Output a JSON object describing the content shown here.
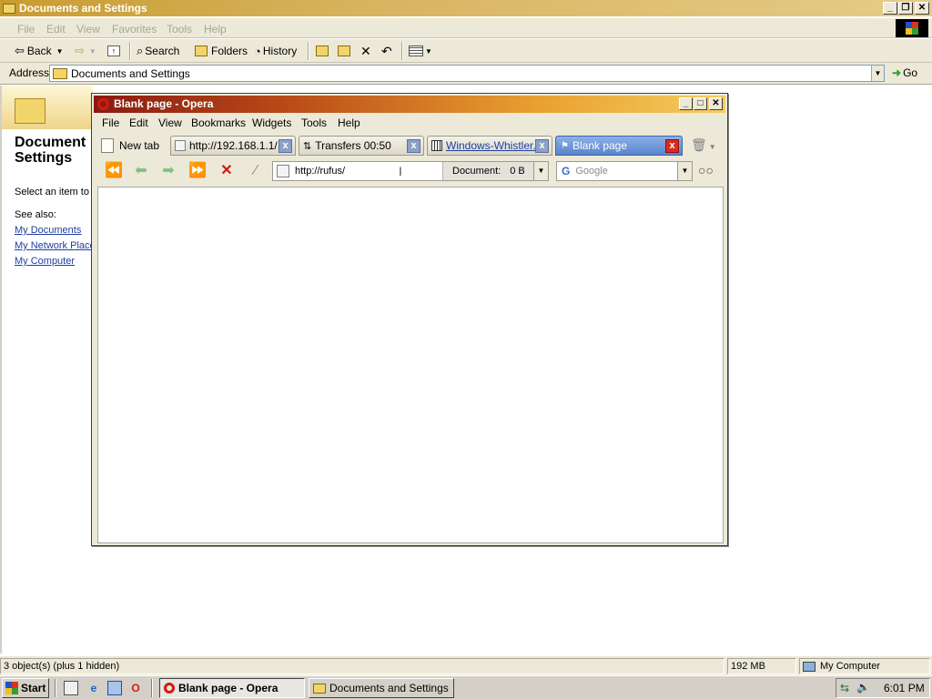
{
  "explorer": {
    "title": "Documents and Settings",
    "menu": [
      "File",
      "Edit",
      "View",
      "Favorites",
      "Tools",
      "Help"
    ],
    "toolbar": {
      "back": "Back",
      "search": "Search",
      "folders": "Folders",
      "history": "History"
    },
    "address_label": "Address",
    "address_value": "Documents and Settings",
    "go": "Go",
    "panel": {
      "title_line1": "Document",
      "title_line2": "Settings",
      "select_text": "Select an item to v",
      "see_also": "See also:",
      "links": [
        "My Documents",
        "My Network Place",
        "My Computer"
      ]
    }
  },
  "opera": {
    "title": "Blank page - Opera",
    "menu": [
      "File",
      "Edit",
      "View",
      "Bookmarks",
      "Widgets",
      "Tools",
      "Help"
    ],
    "new_tab": "New tab",
    "tabs": [
      {
        "label": "http://192.168.1.1/",
        "active": false
      },
      {
        "label": "Transfers 00:50",
        "active": false
      },
      {
        "label": "Windows-Whistler...",
        "active": false
      },
      {
        "label": "Blank page",
        "active": true
      }
    ],
    "url": "http://rufus/",
    "document_label": "Document:",
    "document_size": "0 B",
    "search_placeholder": "Google",
    "search_engine_icon": "G"
  },
  "statusbar": {
    "objects": "3 object(s) (plus 1 hidden)",
    "memory": "192 MB",
    "zone": "My Computer"
  },
  "taskbar": {
    "start": "Start",
    "tasks": [
      {
        "label": "Blank page - Opera",
        "active": true
      },
      {
        "label": "Documents and Settings",
        "active": false
      }
    ],
    "clock": "6:01 PM"
  },
  "colors": {
    "xp_olive": "#ece9d8",
    "link": "#1f3fa0",
    "opera_red": "#d01c10",
    "active_tab": "#5a84cc"
  }
}
